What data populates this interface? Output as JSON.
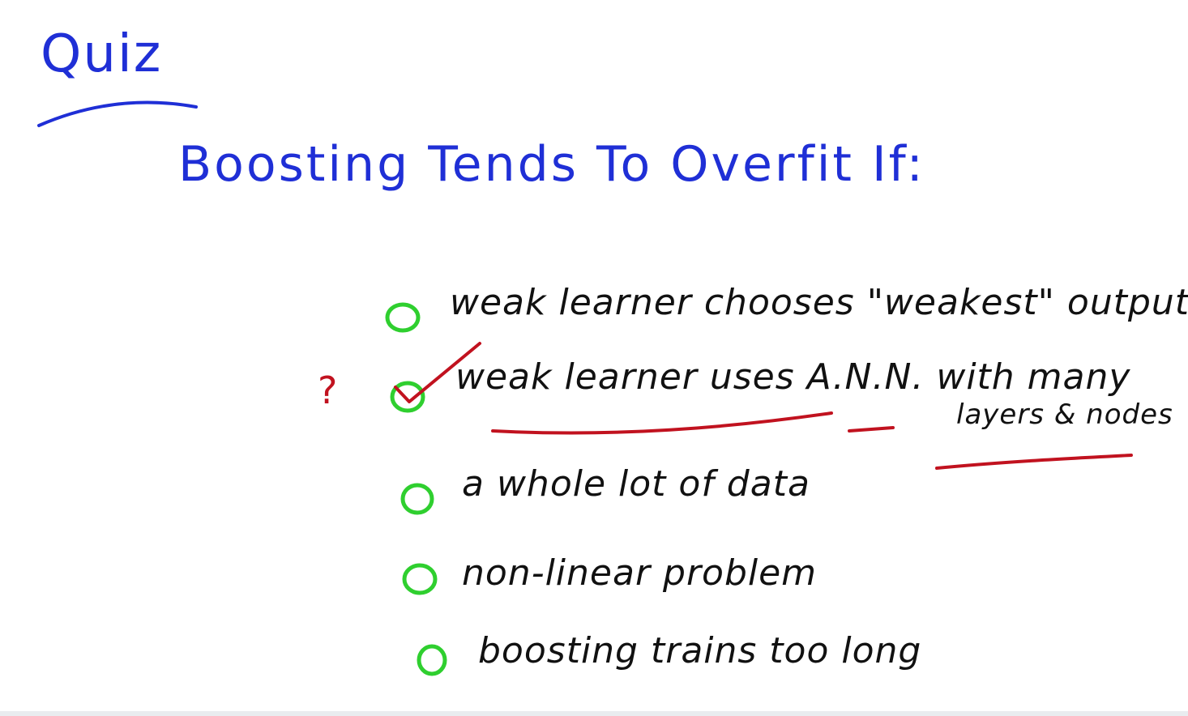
{
  "slide": {
    "title": "Quiz",
    "question": "Boosting Tends To Overfit If:",
    "options": [
      {
        "text": "weak learner chooses \"weakest\" output",
        "checked": false
      },
      {
        "text": "weak learner uses A.N.N. with many",
        "continuation": "layers & nodes",
        "checked": true
      },
      {
        "text": "a whole lot of data",
        "checked": false
      },
      {
        "text": "non-linear problem",
        "checked": false
      },
      {
        "text": "boosting trains too long",
        "checked": false
      }
    ],
    "annotation": "?",
    "colors": {
      "title_ink": "#1f2fd6",
      "body_ink": "#111111",
      "checkbox_ink": "#2fcf2f",
      "annotation_ink": "#c1121f"
    }
  }
}
